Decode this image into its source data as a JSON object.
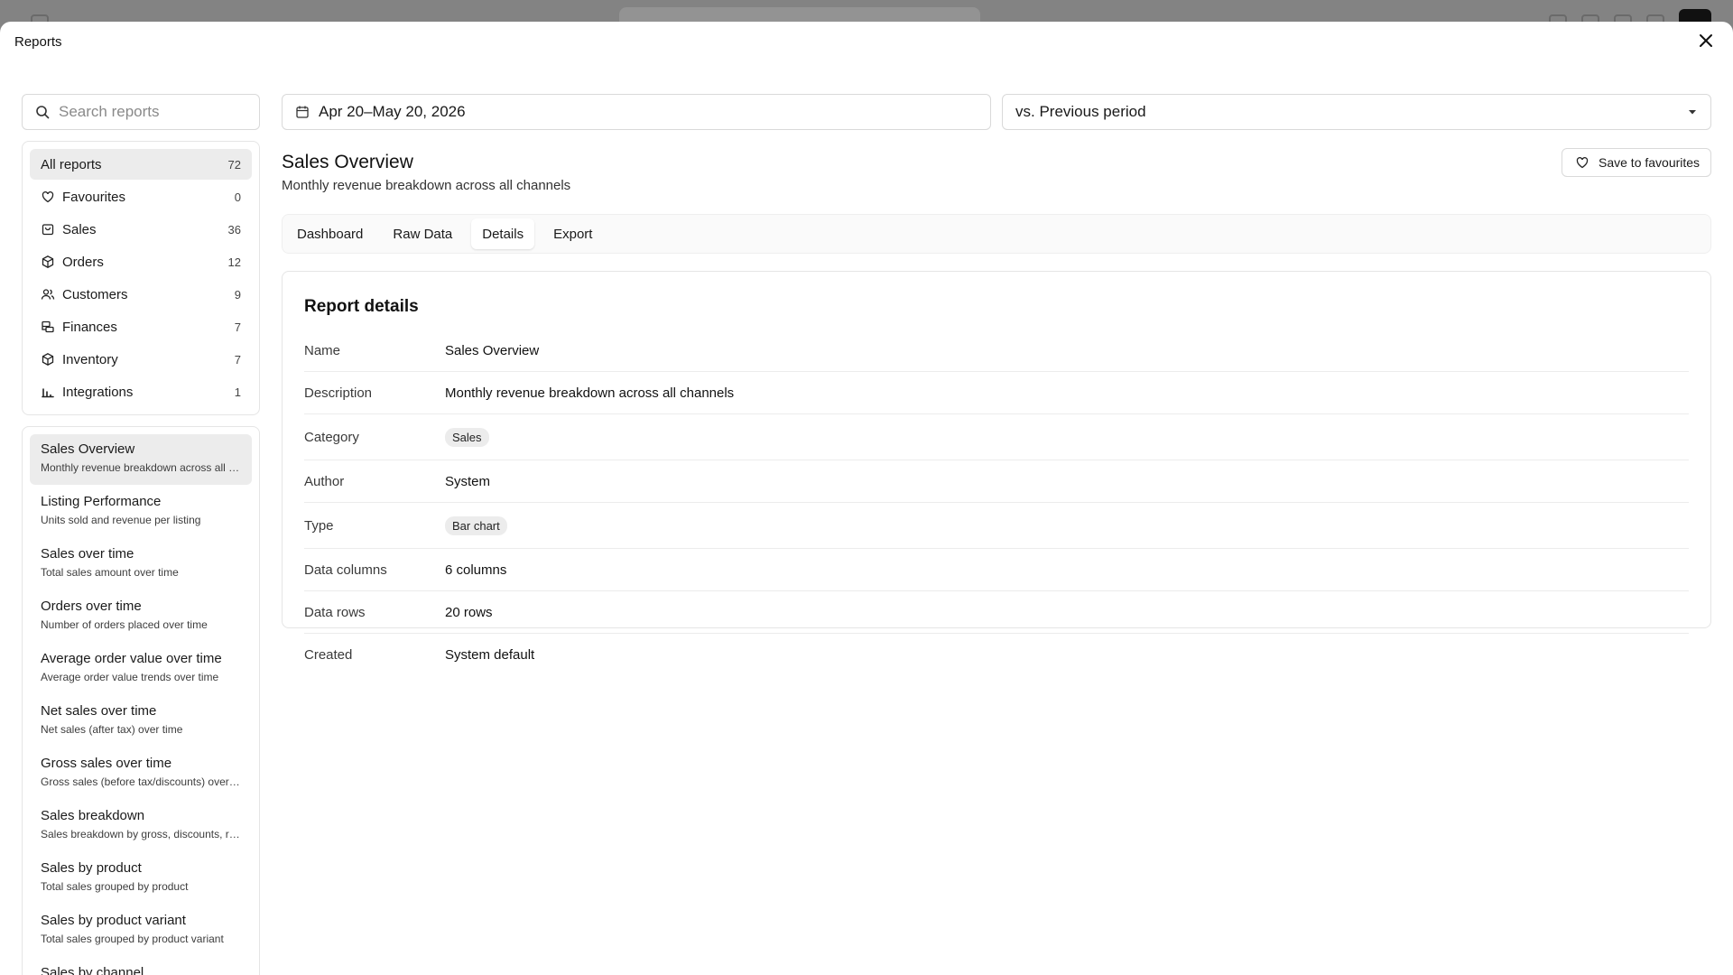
{
  "modal": {
    "title": "Reports"
  },
  "search": {
    "placeholder": "Search reports"
  },
  "categories": [
    {
      "label": "All reports",
      "count": "72",
      "icon": "none"
    },
    {
      "label": "Favourites",
      "count": "0",
      "icon": "heart-icon"
    },
    {
      "label": "Sales",
      "count": "36",
      "icon": "shopping-bag-icon"
    },
    {
      "label": "Orders",
      "count": "12",
      "icon": "package-icon"
    },
    {
      "label": "Customers",
      "count": "9",
      "icon": "users-icon"
    },
    {
      "label": "Finances",
      "count": "7",
      "icon": "coins-icon"
    },
    {
      "label": "Inventory",
      "count": "7",
      "icon": "package-icon"
    },
    {
      "label": "Integrations",
      "count": "1",
      "icon": "bar-chart-icon"
    }
  ],
  "reports": [
    {
      "title": "Sales Overview",
      "subtitle": "Monthly revenue breakdown across all channels"
    },
    {
      "title": "Listing Performance",
      "subtitle": "Units sold and revenue per listing"
    },
    {
      "title": "Sales over time",
      "subtitle": "Total sales amount over time"
    },
    {
      "title": "Orders over time",
      "subtitle": "Number of orders placed over time"
    },
    {
      "title": "Average order value over time",
      "subtitle": "Average order value trends over time"
    },
    {
      "title": "Net sales over time",
      "subtitle": "Net sales (after tax) over time"
    },
    {
      "title": "Gross sales over time",
      "subtitle": "Gross sales (before tax/discounts) over time"
    },
    {
      "title": "Sales breakdown",
      "subtitle": "Sales breakdown by gross, discounts, returns"
    },
    {
      "title": "Sales by product",
      "subtitle": "Total sales grouped by product"
    },
    {
      "title": "Sales by product variant",
      "subtitle": "Total sales grouped by product variant"
    },
    {
      "title": "Sales by channel",
      "subtitle": ""
    }
  ],
  "filters": {
    "date_range": "Apr 20–May 20, 2026",
    "comparison": "vs. Previous period"
  },
  "page": {
    "title": "Sales Overview",
    "subtitle": "Monthly revenue breakdown across all channels",
    "favourite_label": "Save to favourites"
  },
  "tabs": [
    "Dashboard",
    "Raw Data",
    "Details",
    "Export"
  ],
  "details": {
    "heading": "Report details",
    "rows": [
      {
        "label": "Name",
        "value": "Sales Overview",
        "pill": false
      },
      {
        "label": "Description",
        "value": "Monthly revenue breakdown across all channels",
        "pill": false
      },
      {
        "label": "Category",
        "value": "Sales",
        "pill": true
      },
      {
        "label": "Author",
        "value": "System",
        "pill": false
      },
      {
        "label": "Type",
        "value": "Bar chart",
        "pill": true
      },
      {
        "label": "Data columns",
        "value": "6 columns",
        "pill": false
      },
      {
        "label": "Data rows",
        "value": "20 rows",
        "pill": false
      },
      {
        "label": "Created",
        "value": "System default",
        "pill": false
      }
    ]
  }
}
